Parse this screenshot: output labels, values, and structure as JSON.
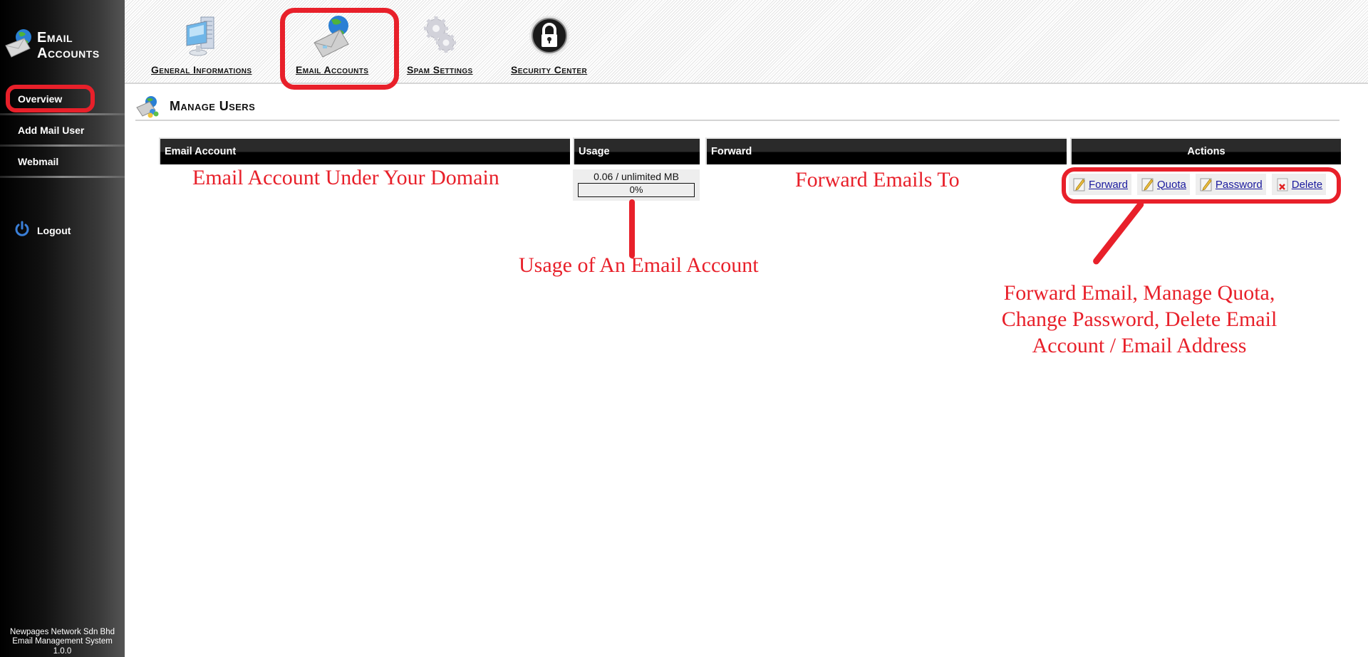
{
  "sidebar": {
    "brand_title_line1": "Email",
    "brand_title_line2": "Accounts",
    "brand_icon": "email-globe-icon",
    "nav": [
      {
        "label": "Overview",
        "active": true
      },
      {
        "label": "Add Mail User",
        "active": false
      },
      {
        "label": "Webmail",
        "active": false
      }
    ],
    "logout_label": "Logout",
    "logout_icon": "power-icon",
    "footer": {
      "line1": "Newpages Network Sdn Bhd",
      "line2": "Email Management System",
      "line3": "1.0.0"
    }
  },
  "topnav": {
    "tabs": [
      {
        "label": "General Informations",
        "icon": "computer-icon"
      },
      {
        "label": "Email Accounts",
        "icon": "email-globe-icon",
        "active": true
      },
      {
        "label": "Spam Settings",
        "icon": "gears-icon"
      },
      {
        "label": "Security Center",
        "icon": "padlock-icon"
      }
    ]
  },
  "section": {
    "title": "Manage Users",
    "icon": "manage-users-icon"
  },
  "table": {
    "columns": [
      "Email Account",
      "Usage",
      "Forward",
      "Actions"
    ],
    "rows": [
      {
        "email_account": "",
        "usage": {
          "text": "0.06 / unlimited MB",
          "percent_label": "0%",
          "percent": 0
        },
        "forward": "",
        "actions": [
          {
            "label": "Forward",
            "icon": "edit-pencil-icon"
          },
          {
            "label": "Quota",
            "icon": "edit-pencil-icon"
          },
          {
            "label": "Password",
            "icon": "edit-pencil-icon"
          },
          {
            "label": "Delete",
            "icon": "delete-x-icon"
          }
        ]
      }
    ]
  },
  "annotations": {
    "email_account": "Email Account Under Your Domain",
    "forward": "Forward Emails To",
    "usage": "Usage of An Email Account",
    "actions": "Forward Email, Manage Quota, Change Password, Delete Email Account / Email Address",
    "color": "#e8202a"
  }
}
